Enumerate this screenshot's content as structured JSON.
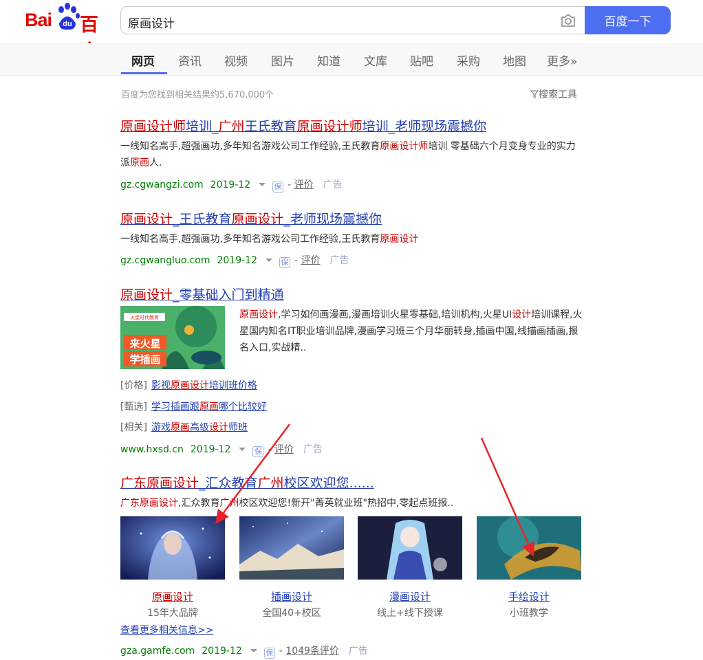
{
  "header": {
    "logo_left": "Bai",
    "logo_mid": "du",
    "logo_right": "百度",
    "query": "原画设计",
    "search_button": "百度一下"
  },
  "nav": {
    "tabs": [
      "网页",
      "资讯",
      "视频",
      "图片",
      "知道",
      "文库",
      "贴吧",
      "采购",
      "地图",
      "更多»"
    ],
    "active_index": 0
  },
  "result_count": "百度为您找到相关结果约5,670,000个",
  "search_tools": "搜索工具",
  "results": [
    {
      "title": [
        "原画设计师",
        "培训_",
        "广州",
        "王氏教育",
        "原画设计师",
        "培训_老师现场震撼你"
      ],
      "desc": [
        "一线知名高手,超强画功,多年知名游戏公司工作经验,王氏教育",
        "原画设计师",
        "培训 零基础六个月变身专业的实力派",
        "原画",
        "人."
      ],
      "domain": "gz.cgwangzi.com",
      "date": "2019-12",
      "review": "评价",
      "ad": "广告"
    },
    {
      "title": [
        "原画设计",
        "_王氏教育",
        "原画设计",
        "_老师现场震撼你"
      ],
      "desc": [
        "一线知名高手,超强画功,多年知名游戏公司工作经验,王氏教育",
        "原画设计"
      ],
      "domain": "gz.cgwangluo.com",
      "date": "2019-12",
      "review": "评价",
      "ad": "广告"
    },
    {
      "title": [
        "原画设计",
        "_零基础入门到精通"
      ],
      "thumb_badge": "火星时代教育",
      "thumb_text_1": "来火星",
      "thumb_text_2": "学插画",
      "desc": [
        "原画设计",
        ",学习如何画漫画,漫画培训火星零基础,培训机构,火星UI",
        "设计",
        "培训课程,火星国内知名IT职业培训品牌,漫画学习班三个月华丽转身,插画中国,线描画插画,报名入口,实战精.."
      ],
      "related": [
        {
          "tag": "[价格]",
          "link": [
            "影视",
            "原画设计",
            "培训班价格"
          ]
        },
        {
          "tag": "[甄选]",
          "link": [
            "学习插画跟",
            "原画",
            "哪个比较好"
          ]
        },
        {
          "tag": "[相关]",
          "link": [
            "游戏",
            "原画",
            "高级",
            "设计",
            "师班"
          ]
        }
      ],
      "domain": "www.hxsd.cn",
      "date": "2019-12",
      "review": "评价",
      "ad": "广告"
    },
    {
      "title": [
        "广东",
        "原画设计",
        "_汇众教育",
        "广州",
        "校区欢迎您......"
      ],
      "desc": [
        "广东",
        "原画设计",
        ",汇众教育",
        "广州",
        "校区欢迎您!新开\"菁英就业班\"热招中,零起点班报.."
      ],
      "images": [
        {
          "caption": "原画设计",
          "sub": "15年大品牌"
        },
        {
          "caption": "插画设计",
          "sub": "全国40+校区"
        },
        {
          "caption": "漫画设计",
          "sub": "线上+线下授课"
        },
        {
          "caption": "手绘设计",
          "sub": "小班教学"
        }
      ],
      "more": "查看更多相关信息>>",
      "domain": "gza.gamfe.com",
      "date": "2019-12",
      "review": "1049条评价",
      "ad": "广告"
    }
  ],
  "bao_glyph": "保",
  "colors": {
    "brand_red": "#e10601",
    "brand_blue": "#2932e1",
    "button_blue": "#4e6ef2",
    "link_blue": "#2440b3",
    "highlight_red": "#c00",
    "url_green": "#008000",
    "arrow_red": "#e8232b"
  }
}
